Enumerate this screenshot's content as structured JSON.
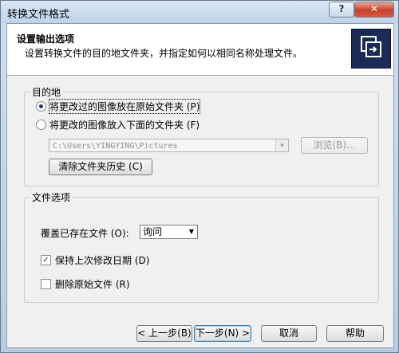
{
  "window": {
    "title": "转换文件格式",
    "help_label": "?",
    "close_label": "✕"
  },
  "header": {
    "title": "设置输出选项",
    "subtitle": "设置转换文件的目的地文件夹，并指定如何以相同名称处理文件。",
    "icon": "copy-folder-icon"
  },
  "destination": {
    "group_label": "目的地",
    "option_original": "将更改过的图像放在原始文件夹 (P)",
    "option_below": "将更改的图像放入下面的文件夹 (F)",
    "selected": "option_original",
    "folder_path": "C:\\Users\\YINGYING\\Pictures",
    "browse_label": "浏览(B)...",
    "clear_history_label": "清除文件夹历史 (C)"
  },
  "file_options": {
    "group_label": "文件选项",
    "overwrite_label": "覆盖已存在文件 (O):",
    "overwrite_value": "询问",
    "keep_date_label": "保持上次修改日期 (D)",
    "keep_date_checked": true,
    "delete_original_label": "删除原始文件 (R)",
    "delete_original_checked": false
  },
  "footer": {
    "back_label": "< 上一步(B)",
    "next_label": "下一步(N) >",
    "cancel_label": "取消",
    "help_label": "帮助"
  }
}
